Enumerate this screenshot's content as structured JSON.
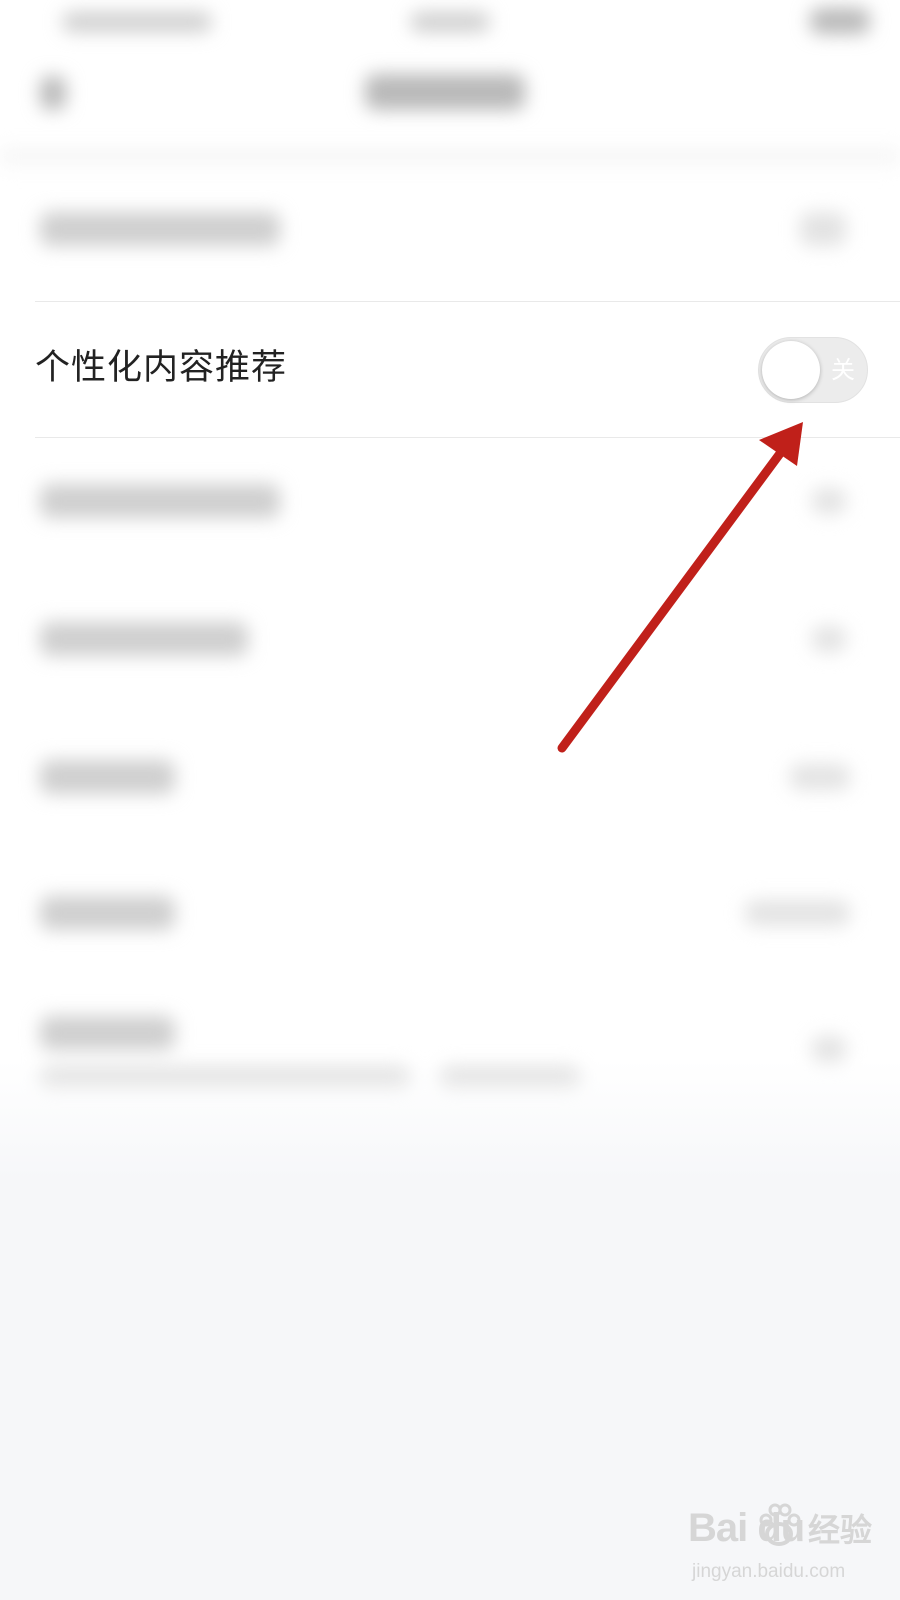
{
  "settings": {
    "focused_row": {
      "label": "个性化内容推荐",
      "toggle_state_text": "关",
      "toggle_on": false
    }
  },
  "colors": {
    "annotation_arrow": "#c0201a",
    "toggle_track_off": "#ececec",
    "page_background": "#f6f7f9"
  },
  "watermark": {
    "logo": "Bai du",
    "brand": "经验",
    "url": "jingyan.baidu.com"
  },
  "icons": {
    "annotation": "red-arrow-icon",
    "watermark": "baidu-paw-icon"
  }
}
